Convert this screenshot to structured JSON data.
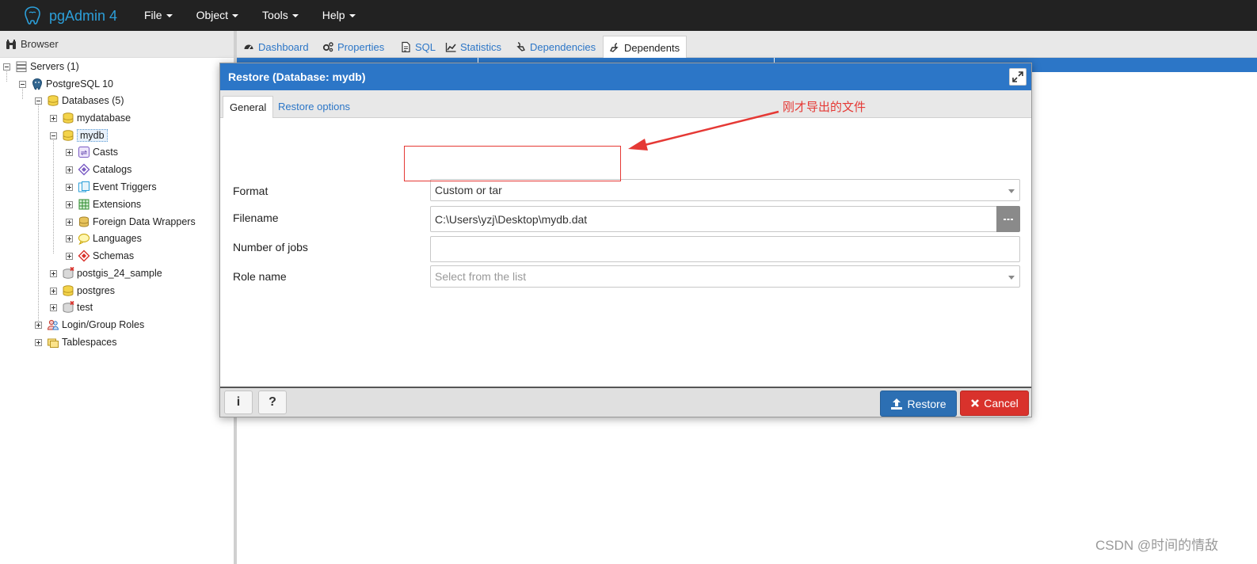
{
  "app": {
    "brand": "pgAdmin 4",
    "menu": [
      "File",
      "Object",
      "Tools",
      "Help"
    ]
  },
  "browser": {
    "title": "Browser",
    "tree": [
      {
        "label": "Servers (1)",
        "icon": "servers-icon",
        "toggle": "minus"
      },
      {
        "label": "PostgreSQL 10",
        "icon": "elephant-icon",
        "toggle": "minus"
      },
      {
        "label": "Databases (5)",
        "icon": "database-icon",
        "toggle": "minus"
      },
      {
        "label": "mydatabase",
        "icon": "database-icon",
        "toggle": "plus"
      },
      {
        "label": "mydb",
        "icon": "database-icon",
        "toggle": "minus"
      },
      {
        "label": "Casts",
        "icon": "casts-icon",
        "toggle": "plus"
      },
      {
        "label": "Catalogs",
        "icon": "catalog-icon",
        "toggle": "plus"
      },
      {
        "label": "Event Triggers",
        "icon": "event-trigger-icon",
        "toggle": "plus"
      },
      {
        "label": "Extensions",
        "icon": "extension-icon",
        "toggle": "plus"
      },
      {
        "label": "Foreign Data Wrappers",
        "icon": "fdw-icon",
        "toggle": "plus"
      },
      {
        "label": "Languages",
        "icon": "language-icon",
        "toggle": "plus"
      },
      {
        "label": "Schemas",
        "icon": "schema-icon",
        "toggle": "plus"
      },
      {
        "label": "postgis_24_sample",
        "icon": "database-disconnected-icon",
        "toggle": "plus"
      },
      {
        "label": "postgres",
        "icon": "database-icon",
        "toggle": "plus"
      },
      {
        "label": "test",
        "icon": "database-disconnected-icon",
        "toggle": "plus"
      },
      {
        "label": "Login/Group Roles",
        "icon": "roles-icon",
        "toggle": "plus"
      },
      {
        "label": "Tablespaces",
        "icon": "tablespace-icon",
        "toggle": "plus"
      }
    ]
  },
  "main_tabs": [
    {
      "label": "Dashboard",
      "icon": "dashboard-icon"
    },
    {
      "label": "Properties",
      "icon": "properties-icon"
    },
    {
      "label": "SQL",
      "icon": "sql-icon"
    },
    {
      "label": "Statistics",
      "icon": "statistics-icon"
    },
    {
      "label": "Dependencies",
      "icon": "dependencies-icon"
    },
    {
      "label": "Dependents",
      "icon": "dependents-icon",
      "active": true
    }
  ],
  "dialog": {
    "title": "Restore (Database: mydb)",
    "tabs": [
      "General",
      "Restore options"
    ],
    "fields": {
      "format": {
        "label": "Format",
        "value": "Custom or tar"
      },
      "filename": {
        "label": "Filename",
        "value": "C:\\Users\\yzj\\Desktop\\mydb.dat"
      },
      "jobs": {
        "label": "Number of jobs",
        "value": ""
      },
      "role": {
        "label": "Role name",
        "placeholder": "Select from the list"
      }
    },
    "footer": {
      "info_label": "i",
      "help_label": "?",
      "restore_label": "Restore",
      "cancel_label": "Cancel"
    }
  },
  "annotation": {
    "text": "刚才导出的文件"
  },
  "watermark": "CSDN @时间的情敌",
  "colors": {
    "navbar": "#222222",
    "brand": "#2c9fd9",
    "accent_blue": "#2c76c7",
    "restore_button": "#2c6fb3",
    "cancel_button": "#d9322c",
    "annotation_red": "#e53935"
  }
}
